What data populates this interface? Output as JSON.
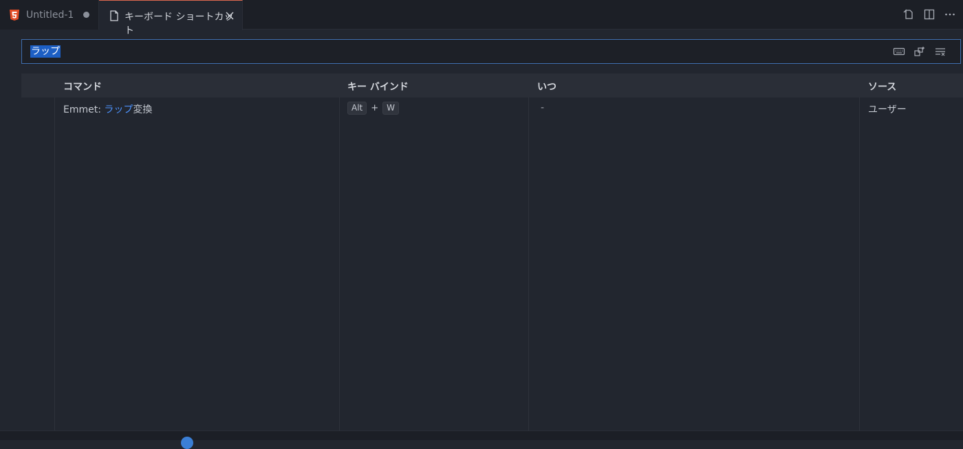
{
  "tabs": [
    {
      "label": "Untitled-1",
      "icon": "html5-icon",
      "dirty": true
    },
    {
      "label": "キーボード ショートカット",
      "icon": "file-icon",
      "active": true
    }
  ],
  "search": {
    "value": "ラップ"
  },
  "table": {
    "headers": {
      "command": "コマンド",
      "keybinding": "キー バインド",
      "when": "いつ",
      "source": "ソース"
    },
    "rows": [
      {
        "command_prefix": "Emmet: ",
        "command_highlight": "ラップ",
        "command_suffix": "変換",
        "keys": [
          "Alt",
          "W"
        ],
        "plus": "+",
        "when": "-",
        "source": "ユーザー"
      }
    ]
  },
  "colors": {
    "accent": "#e0694f",
    "highlight": "#4e94ff",
    "selection": "#1d5fc4"
  }
}
